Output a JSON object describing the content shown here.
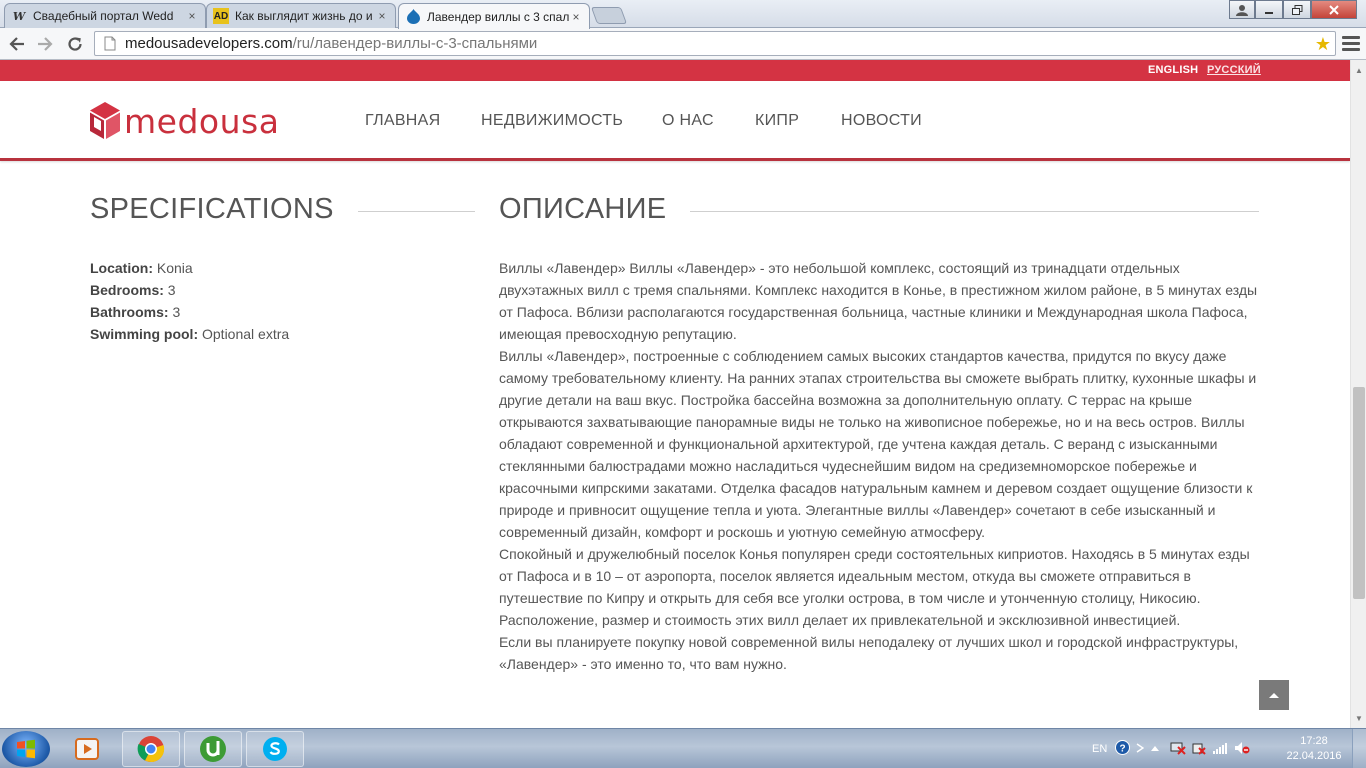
{
  "browser": {
    "tabs": [
      {
        "title": "Свадебный портал Wedd",
        "favicon": "W"
      },
      {
        "title": "Как выглядит жизнь до и",
        "favicon": "AD"
      },
      {
        "title": "Лавендер виллы с 3 спал",
        "favicon": "drupal-drop"
      }
    ],
    "close_glyph": "×",
    "url_host": "medousadevelopers.com",
    "url_path": "/ru/лавендер-виллы-с-3-спальнями"
  },
  "site": {
    "languages": [
      "ENGLISH",
      "РУССКИЙ"
    ],
    "logo_text": "medousa",
    "brand_color": "#d43343",
    "nav": [
      "ГЛАВНАЯ",
      "НЕДВИЖИМОСТЬ",
      "О НАС",
      "КИПР",
      "НОВОСТИ"
    ]
  },
  "specifications": {
    "title": "SPECIFICATIONS",
    "items": [
      {
        "label": "Location:",
        "value": "Konia"
      },
      {
        "label": "Bedrooms:",
        "value": "3"
      },
      {
        "label": "Bathrooms:",
        "value": "3"
      },
      {
        "label": "Swimming pool:",
        "value": "Optional extra"
      }
    ]
  },
  "description": {
    "title": "ОПИСАНИЕ",
    "paragraphs": [
      "Виллы «Лавендер» Виллы «Лавендер» - это небольшой комплекс, состоящий из тринадцати отдельных двухэтажных вилл с тремя спальнями. Комплекс находится в Конье, в престижном жилом районе, в 5 минутах езды от Пафоса. Вблизи располагаются государственная больница, частные клиники и Международная школа Пафоса, имеющая превосходную репутацию.",
      "Виллы «Лавендер», построенные с соблюдением самых высоких стандартов качества, придутся по вкусу даже самому требовательному клиенту. На ранних этапах строительства вы сможете выбрать плитку, кухонные шкафы и другие детали на ваш вкус. Постройка бассейна возможна за дополнительную оплату. С террас на крыше открываются захватывающие панорамные виды не только на живописное побережье, но и на весь остров. Виллы обладают современной и функциональной архитектурой, где учтена каждая деталь. С веранд с изысканными стеклянными балюстрадами можно насладиться чудеснейшим видом на средиземноморское побережье и красочными кипрскими закатами. Отделка фасадов натуральным камнем и деревом создает ощущение близости к природе и привносит ощущение тепла и уюта. Элегантные виллы «Лавендер» сочетают в себе изысканный и современный дизайн, комфорт и роскошь и уютную семейную атмосферу.",
      "Спокойный и дружелюбный поселок Конья популярен среди состоятельных киприотов. Находясь в 5 минутах езды от Пафоса и в 10 – от аэропорта, поселок является идеальным местом, откуда вы сможете отправиться в путешествие по Кипру и открыть для себя все уголки острова, в том числе и утонченную столицу, Никосию. Расположение, размер и стоимость этих вилл делает их привлекательной и эксклюзивной инвестицией.",
      "Если вы планируете покупку новой современной вилы неподалеку от лучших школ и городской инфраструктуры, «Лавендер» - это именно то, что вам нужно."
    ]
  },
  "taskbar": {
    "apps": [
      "media-player-icon",
      "chrome-icon",
      "utorrent-icon",
      "skype-icon"
    ],
    "language": "EN",
    "time": "17:28",
    "date": "22.04.2016"
  }
}
